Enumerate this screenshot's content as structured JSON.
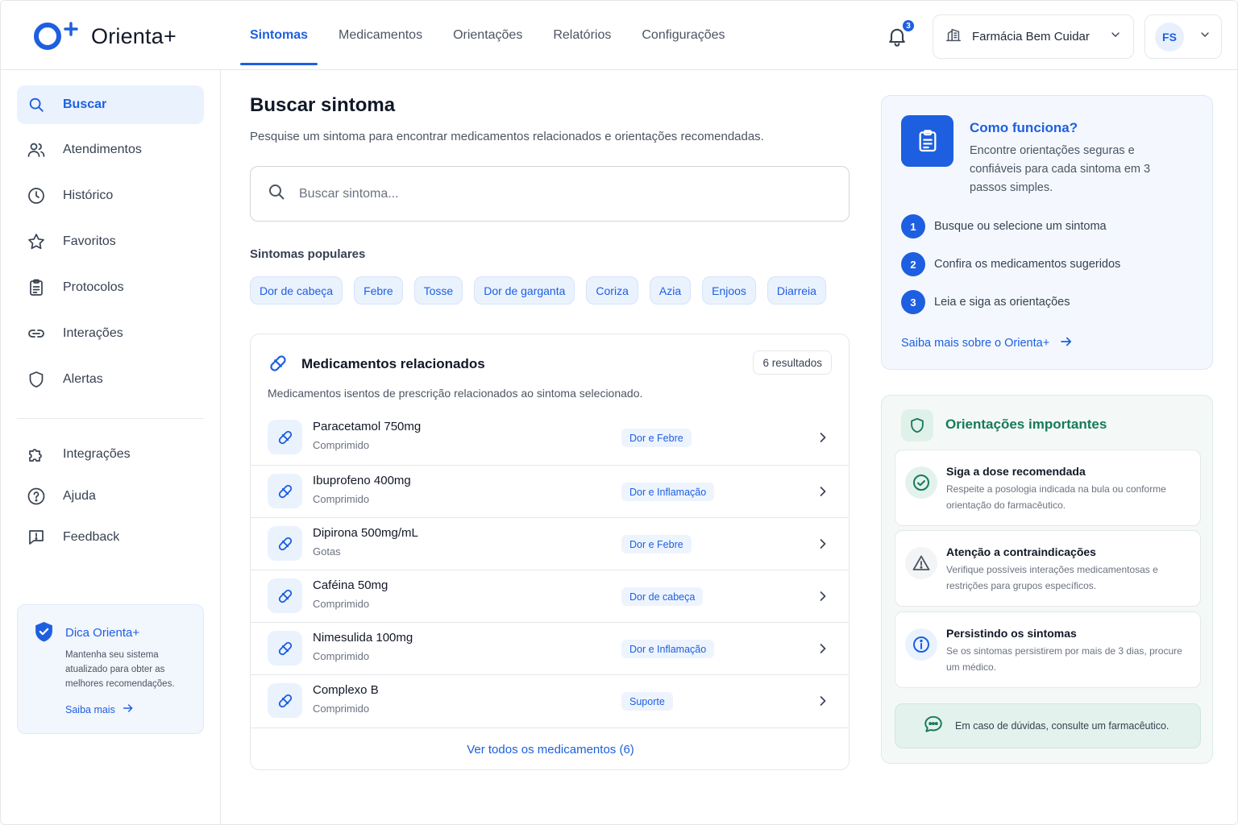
{
  "app": {
    "name": "Orienta+"
  },
  "nav": {
    "items": [
      {
        "label": "Sintomas",
        "active": true
      },
      {
        "label": "Medicamentos",
        "active": false
      },
      {
        "label": "Orientações",
        "active": false
      },
      {
        "label": "Relatórios",
        "active": false
      },
      {
        "label": "Configurações",
        "active": false
      }
    ]
  },
  "header": {
    "notifications_count": "3",
    "store": "Farmácia Bem Cuidar",
    "user_initials": "FS"
  },
  "sidebar": {
    "items": [
      {
        "label": "Buscar",
        "icon": "search-icon",
        "active": true
      },
      {
        "label": "Atendimentos",
        "icon": "users-icon",
        "active": false
      },
      {
        "label": "Histórico",
        "icon": "clock-icon",
        "active": false
      },
      {
        "label": "Favoritos",
        "icon": "star-icon",
        "active": false
      },
      {
        "label": "Protocolos",
        "icon": "clipboard-icon",
        "active": false
      },
      {
        "label": "Interações",
        "icon": "link-icon",
        "active": false
      },
      {
        "label": "Alertas",
        "icon": "shield-icon",
        "active": false
      }
    ],
    "secondary": [
      {
        "label": "Integrações",
        "icon": "puzzle-icon"
      },
      {
        "label": "Ajuda",
        "icon": "help-circle-icon"
      },
      {
        "label": "Feedback",
        "icon": "message-alert-icon"
      }
    ],
    "tip": {
      "title": "Dica Orienta+",
      "body": "Mantenha seu sistema atualizado para obter as melhores recomendações.",
      "link": "Saiba mais"
    }
  },
  "main": {
    "title": "Buscar sintoma",
    "subtitle": "Pesquise um sintoma para encontrar medicamentos relacionados e orientações recomendadas.",
    "search": {
      "placeholder": "Buscar sintoma..."
    },
    "popular_title": "Sintomas populares",
    "popular": [
      "Dor de cabeça",
      "Febre",
      "Tosse",
      "Dor de garganta",
      "Coriza",
      "Azia",
      "Enjoos",
      "Diarreia"
    ],
    "meds": {
      "title": "Medicamentos relacionados",
      "subtitle": "Medicamentos isentos de prescrição relacionados ao sintoma selecionado.",
      "count": "6 resultados",
      "items": [
        {
          "name": "Paracetamol 750mg",
          "form": "Comprimido",
          "tag": "Dor e Febre"
        },
        {
          "name": "Ibuprofeno 400mg",
          "form": "Comprimido",
          "tag": "Dor e Inflamação"
        },
        {
          "name": "Dipirona 500mg/mL",
          "form": "Gotas",
          "tag": "Dor e Febre"
        },
        {
          "name": "Caféina 50mg",
          "form": "Comprimido",
          "tag": "Dor de cabeça"
        },
        {
          "name": "Nimesulida 100mg",
          "form": "Comprimido",
          "tag": "Dor e Inflamação"
        },
        {
          "name": "Complexo B",
          "form": "Comprimido",
          "tag": "Suporte"
        }
      ],
      "footer": "Ver todos os medicamentos (6)"
    }
  },
  "how": {
    "title": "Como funciona?",
    "body": "Encontre orientações seguras e confiáveis para cada sintoma em 3 passos simples.",
    "steps": [
      {
        "num": "1",
        "text": "Busque ou selecione um sintoma"
      },
      {
        "num": "2",
        "text": "Confira os medicamentos sugeridos"
      },
      {
        "num": "3",
        "text": "Leia e siga as orientações"
      }
    ],
    "link": "Saiba mais sobre o Orienta+"
  },
  "guide": {
    "title": "Orientações importantes",
    "cards": [
      {
        "title": "Siga a dose recomendada",
        "body": "Respeite a posologia indicada na bula ou conforme orientação do farmacêutico.",
        "icon": "check-circle-icon"
      },
      {
        "title": "Atenção a contraindicações",
        "body": "Verifique possíveis interações medicamentosas e restrições para grupos específicos.",
        "icon": "warning-icon"
      },
      {
        "title": "Persistindo os sintomas",
        "body": "Se os sintomas persistirem por mais de 3 dias, procure um médico.",
        "icon": "info-icon"
      }
    ],
    "note": "Em caso de dúvidas, consulte um farmacêutico."
  },
  "colors": {
    "primary": "#1d5fe0",
    "success": "#167a5b",
    "border": "#e5e7eb"
  }
}
